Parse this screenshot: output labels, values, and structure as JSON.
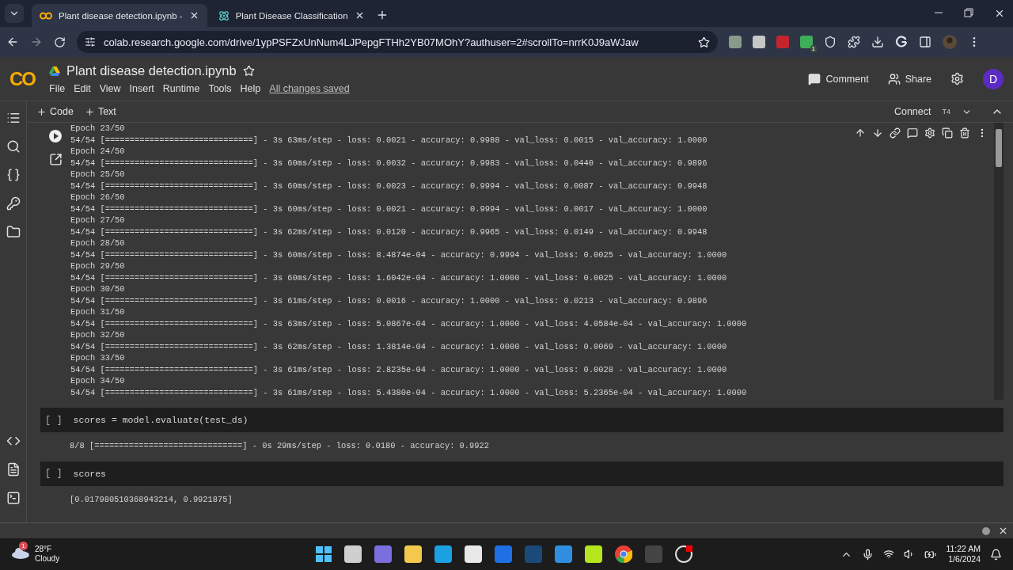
{
  "browser": {
    "tabs": [
      {
        "title": "Plant disease detection.ipynb -",
        "kind": "colab",
        "selected": true
      },
      {
        "title": "Plant Disease Classification",
        "kind": "react",
        "selected": false
      }
    ],
    "url": "colab.research.google.com/drive/1ypPSFZxUnNum4LJPepgFTHh2YB07MOhY?authuser=2#scrollTo=nrrK0J9aWJaw",
    "extension_badge": "1"
  },
  "notebook": {
    "logo": "CO",
    "title": "Plant disease detection.ipynb",
    "menu": [
      "File",
      "Edit",
      "View",
      "Insert",
      "Runtime",
      "Tools",
      "Help"
    ],
    "save_status": "All changes saved",
    "comment": "Comment",
    "share": "Share",
    "avatar": "D",
    "add_buttons": [
      "Code",
      "Text"
    ],
    "connect": "Connect",
    "runtime": "T4"
  },
  "cells": [
    {
      "kind": "output",
      "lines": [
        "Epoch 23/50",
        "54/54 [==============================] - 3s 63ms/step - loss: 0.0021 - accuracy: 0.9988 - val_loss: 0.0015 - val_accuracy: 1.0000",
        "Epoch 24/50",
        "54/54 [==============================] - 3s 60ms/step - loss: 0.0032 - accuracy: 0.9983 - val_loss: 0.0440 - val_accuracy: 0.9896",
        "Epoch 25/50",
        "54/54 [==============================] - 3s 60ms/step - loss: 0.0023 - accuracy: 0.9994 - val_loss: 0.0087 - val_accuracy: 0.9948",
        "Epoch 26/50",
        "54/54 [==============================] - 3s 60ms/step - loss: 0.0021 - accuracy: 0.9994 - val_loss: 0.0017 - val_accuracy: 1.0000",
        "Epoch 27/50",
        "54/54 [==============================] - 3s 62ms/step - loss: 0.0120 - accuracy: 0.9965 - val_loss: 0.0149 - val_accuracy: 0.9948",
        "Epoch 28/50",
        "54/54 [==============================] - 3s 60ms/step - loss: 8.4874e-04 - accuracy: 0.9994 - val_loss: 0.0025 - val_accuracy: 1.0000",
        "Epoch 29/50",
        "54/54 [==============================] - 3s 60ms/step - loss: 1.6042e-04 - accuracy: 1.0000 - val_loss: 0.0025 - val_accuracy: 1.0000",
        "Epoch 30/50",
        "54/54 [==============================] - 3s 61ms/step - loss: 0.0016 - accuracy: 1.0000 - val_loss: 0.0213 - val_accuracy: 0.9896",
        "Epoch 31/50",
        "54/54 [==============================] - 3s 63ms/step - loss: 5.0867e-04 - accuracy: 1.0000 - val_loss: 4.0584e-04 - val_accuracy: 1.0000",
        "Epoch 32/50",
        "54/54 [==============================] - 3s 62ms/step - loss: 1.3814e-04 - accuracy: 1.0000 - val_loss: 0.0069 - val_accuracy: 1.0000",
        "Epoch 33/50",
        "54/54 [==============================] - 3s 61ms/step - loss: 2.8235e-04 - accuracy: 1.0000 - val_loss: 0.0028 - val_accuracy: 1.0000",
        "Epoch 34/50",
        "54/54 [==============================] - 3s 61ms/step - loss: 5.4380e-04 - accuracy: 1.0000 - val_loss: 5.2365e-04 - val_accuracy: 1.0000"
      ]
    },
    {
      "kind": "code",
      "prompt": "[ ]",
      "code": "scores = model.evaluate(test_ds)",
      "output": "8/8 [==============================] - 0s 29ms/step - loss: 0.0180 - accuracy: 0.9922"
    },
    {
      "kind": "code",
      "prompt": "[ ]",
      "code": "scores",
      "output": "[0.017980510368943214, 0.9921875]"
    }
  ],
  "taskbar": {
    "temperature": "28°F",
    "weather": "Cloudy",
    "weather_badge": "1",
    "time": "11:22 AM",
    "date": "1/6/2024"
  }
}
